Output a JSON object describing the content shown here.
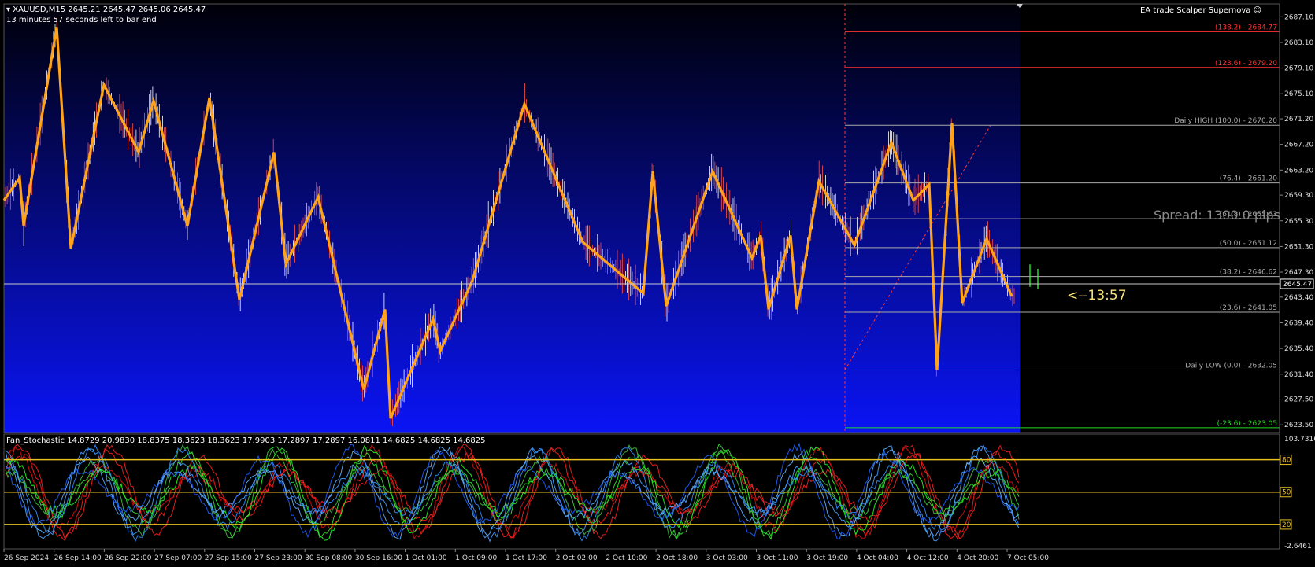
{
  "header": {
    "symbol_line": "XAUUSD,M15  2645.21 2645.47 2645.06 2645.47",
    "timer_line": "13 minutes 57 seconds left to bar end"
  },
  "ea_label": "EA trade Scalper Supernova",
  "spread_label": "Spread: 1300.0 pips",
  "countdown_label": "<--13:57",
  "price_axis": {
    "ticks": [
      "2687.10",
      "2683.10",
      "2679.10",
      "2675.10",
      "2671.20",
      "2667.20",
      "2663.20",
      "2659.30",
      "2655.30",
      "2651.30",
      "2647.30",
      "2643.40",
      "2639.40",
      "2635.40",
      "2631.40",
      "2627.50",
      "2623.50"
    ],
    "current_price": "2645.47"
  },
  "fib_levels": [
    {
      "label": "(138.2) - 2684.77",
      "price": 2684.77,
      "color": "#ff3333"
    },
    {
      "label": "(123.6) - 2679.20",
      "price": 2679.2,
      "color": "#ff3333"
    },
    {
      "label": "Daily HIGH (100.0) - 2670.20",
      "price": 2670.2,
      "color": "#aaaaaa"
    },
    {
      "label": "(76.4) - 2661.20",
      "price": 2661.2,
      "color": "#aaaaaa"
    },
    {
      "label": "(61.8) - 2655.63",
      "price": 2655.63,
      "color": "#aaaaaa"
    },
    {
      "label": "(50.0) - 2651.12",
      "price": 2651.12,
      "color": "#aaaaaa"
    },
    {
      "label": "(38.2) - 2646.62",
      "price": 2646.62,
      "color": "#aaaaaa"
    },
    {
      "label": "(23.6) - 2641.05",
      "price": 2641.05,
      "color": "#aaaaaa"
    },
    {
      "label": "Daily LOW (0.0) - 2632.05",
      "price": 2632.05,
      "color": "#aaaaaa"
    },
    {
      "label": "(-23.6) - 2623.05",
      "price": 2623.05,
      "color": "#22dd22"
    }
  ],
  "zigzag_prices": [
    2658.5,
    2662,
    2654.5,
    2685.5,
    2651,
    2676.5,
    2666,
    2674,
    2654.5,
    2674.5,
    2643,
    2666,
    2648.5,
    2659,
    2646,
    2629,
    2641.5,
    2624.5,
    2640,
    2635,
    2645,
    2673.5,
    2664,
    2644,
    2663,
    2642,
    2663,
    2649.5,
    2653,
    2643.5,
    2653,
    2641.5,
    2661.5,
    2651.5,
    2667.5,
    2658.5,
    2661,
    2632,
    2670.5,
    2642.5,
    2652.5,
    2643.5
  ],
  "oscillator": {
    "title": "Fan_Stochastic 14.8729 20.9830 18.8375 18.3623 18.3623 17.9903 17.2897 17.2897 16.0811 14.6825 14.6825 14.6825",
    "scale_top": "103.7316",
    "scale_bottom": "-2.6461",
    "levels": [
      {
        "value": 80,
        "label": "80"
      },
      {
        "value": 50,
        "label": "50"
      },
      {
        "value": 20,
        "label": "20"
      }
    ],
    "level_color": "#e8c020"
  },
  "time_axis": [
    "26 Sep 2024",
    "26 Sep 14:00",
    "26 Sep 22:00",
    "27 Sep 07:00",
    "27 Sep 15:00",
    "27 Sep 23:00",
    "30 Sep 08:00",
    "30 Sep 16:00",
    "1 Oct 01:00",
    "1 Oct 09:00",
    "1 Oct 17:00",
    "2 Oct 02:00",
    "2 Oct 10:00",
    "2 Oct 18:00",
    "3 Oct 03:00",
    "3 Oct 11:00",
    "3 Oct 19:00",
    "4 Oct 04:00",
    "4 Oct 12:00",
    "4 Oct 20:00",
    "7 Oct 05:00"
  ],
  "colors": {
    "zigzag": "#ffa31a",
    "bull_candle": "#ffffff",
    "bear_candle": "#ff5050",
    "fib_major": "#ff3333",
    "fib_minor": "#aaaaaa",
    "fib_low": "#22dd22"
  }
}
